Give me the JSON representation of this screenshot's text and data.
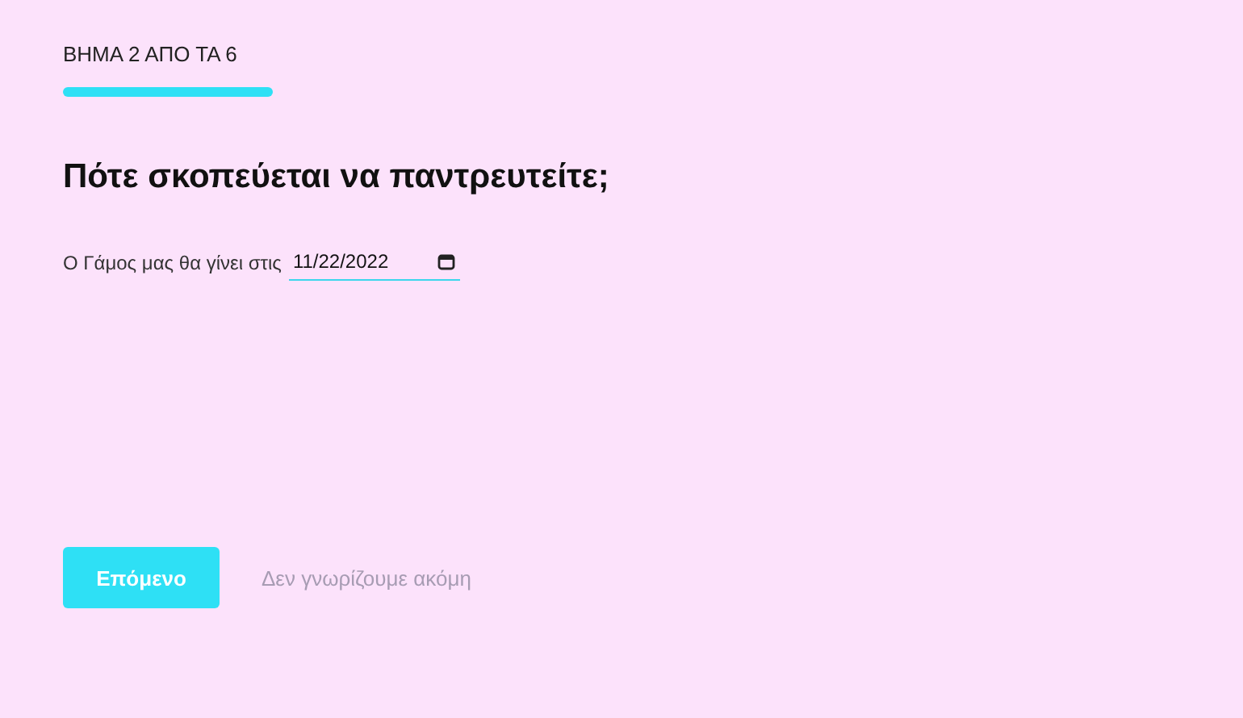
{
  "step_label": "ΒΗΜΑ 2 ΑΠΟ ΤΑ 6",
  "heading": "Πότε σκοπεύεται να παντρευτείτε;",
  "date_field": {
    "label": "Ο Γάμος μας θα γίνει στις",
    "value": "11/22/2022"
  },
  "buttons": [
    {
      "kind": "primary",
      "label": "Επόμενο"
    },
    {
      "kind": "link",
      "label": "Δεν γνωρίζουμε ακόμη"
    }
  ]
}
